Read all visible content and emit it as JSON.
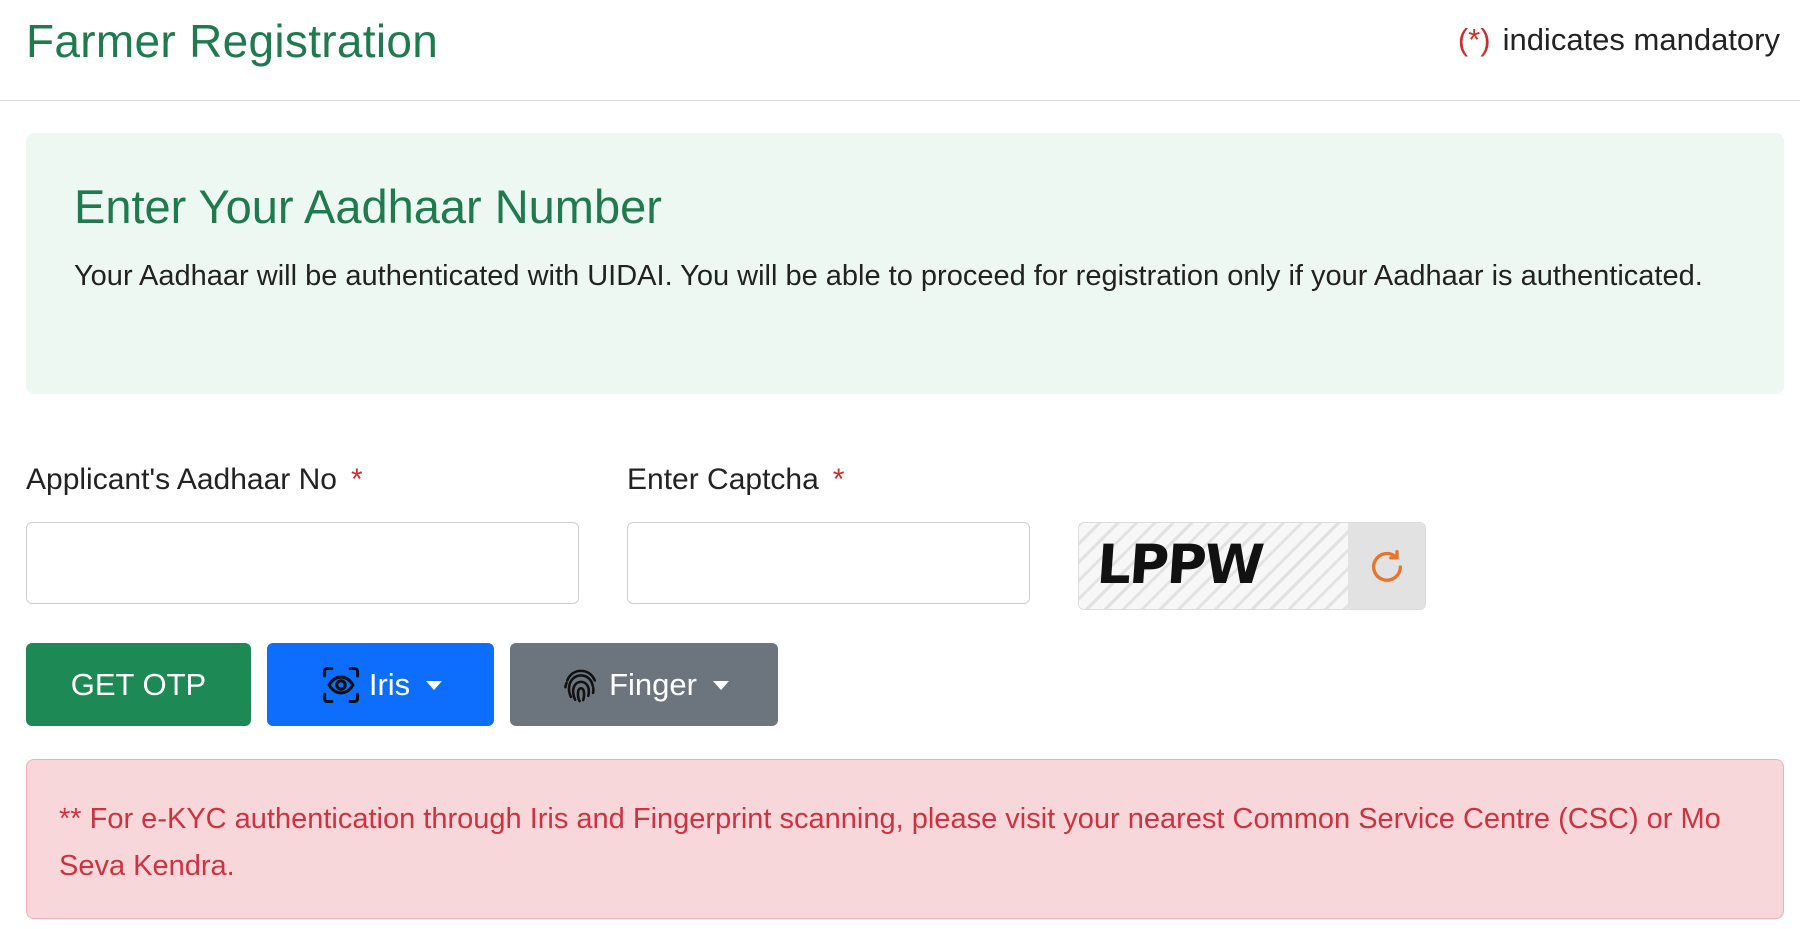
{
  "header": {
    "title": "Farmer Registration",
    "mandatory_mark": "(*)",
    "mandatory_text": "indicates mandatory"
  },
  "info": {
    "title": "Enter Your Aadhaar Number",
    "text": "Your Aadhaar will be authenticated with UIDAI. You will be able to proceed for registration only if your Aadhaar is authenticated."
  },
  "form": {
    "aadhaar_label": "Applicant's Aadhaar No",
    "aadhaar_value": "",
    "captcha_label": "Enter Captcha",
    "captcha_value": "",
    "required_mark": "*",
    "captcha_code": "LPPW"
  },
  "buttons": {
    "otp": "GET OTP",
    "iris": "Iris",
    "finger": "Finger"
  },
  "alert": {
    "text": "** For e-KYC authentication through Iris and Fingerprint scanning, please visit your nearest Common Service Centre (CSC) or Mo Seva Kendra."
  },
  "colors": {
    "brand_green": "#1f7a4d",
    "otp_button": "#1d8a55",
    "iris_button": "#0d6efd",
    "finger_button": "#6c757d",
    "required": "#c9302c",
    "refresh_icon": "#e8742a",
    "alert_text": "#cc3340"
  },
  "icons": {
    "iris": "eye-scan-icon",
    "finger": "fingerprint-icon",
    "refresh": "refresh-icon"
  }
}
